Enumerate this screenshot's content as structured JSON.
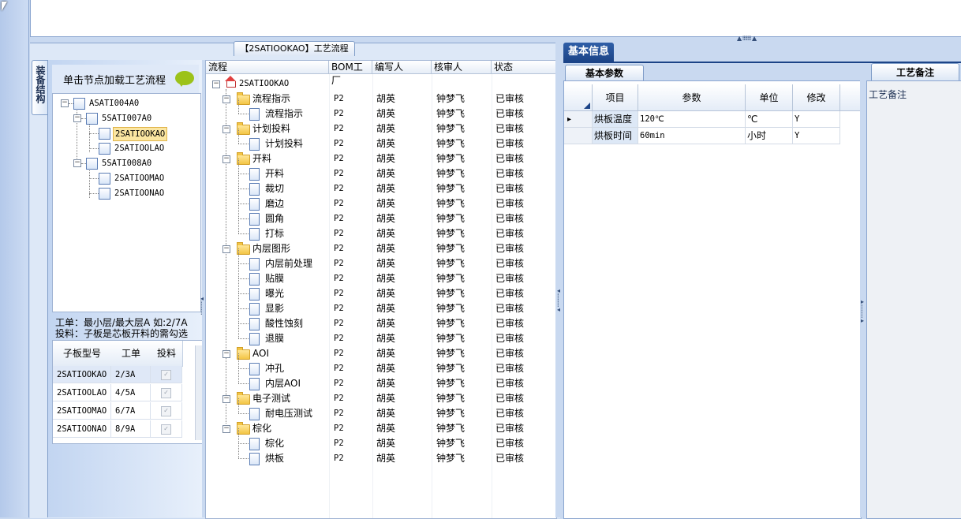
{
  "side_tab": {
    "label": "装备结构"
  },
  "tree": {
    "load_hint": "单击节点加载工艺流程",
    "nodes": [
      {
        "label": "ASATI004A0",
        "level": 0,
        "type": "group"
      },
      {
        "label": "5SATI007A0",
        "level": 1,
        "type": "group"
      },
      {
        "label": "2SATIOOKAO",
        "level": 2,
        "type": "leaf",
        "selected": true
      },
      {
        "label": "2SATIOOLAO",
        "level": 2,
        "type": "leaf"
      },
      {
        "label": "5SATI008A0",
        "level": 1,
        "type": "group"
      },
      {
        "label": "2SATIOOMAO",
        "level": 2,
        "type": "leaf"
      },
      {
        "label": "2SATIOONAO",
        "level": 2,
        "type": "leaf"
      }
    ]
  },
  "work_hint": {
    "line1": "工单：最小层/最大层A 如:2/7A",
    "line2": "投料：子板是芯板开料的需勾选"
  },
  "sub_grid": {
    "headers": [
      "子板型号",
      "工单",
      "投料"
    ],
    "rows": [
      {
        "model": "2SATIOOKAO",
        "order": "2/3A",
        "feed": true
      },
      {
        "model": "2SATIOOLAO",
        "order": "4/5A",
        "feed": true
      },
      {
        "model": "2SATIOOMAO",
        "order": "6/7A",
        "feed": true
      },
      {
        "model": "2SATIOONAO",
        "order": "8/9A",
        "feed": true
      }
    ]
  },
  "process_tab": {
    "label": "【2SATIOOKAO】工艺流程"
  },
  "process_grid": {
    "headers": [
      "流程",
      "BOM工厂",
      "编写人",
      "核审人",
      "状态"
    ],
    "root": "2SATIOOKAO",
    "rows": [
      {
        "label": "流程指示",
        "kind": "folder",
        "bom": "P2",
        "writer": "胡英",
        "reviewer": "钟梦飞",
        "status": "已审核"
      },
      {
        "label": "流程指示",
        "kind": "item",
        "bom": "P2",
        "writer": "胡英",
        "reviewer": "钟梦飞",
        "status": "已审核"
      },
      {
        "label": "计划投料",
        "kind": "folder",
        "bom": "P2",
        "writer": "胡英",
        "reviewer": "钟梦飞",
        "status": "已审核"
      },
      {
        "label": "计划投料",
        "kind": "item",
        "bom": "P2",
        "writer": "胡英",
        "reviewer": "钟梦飞",
        "status": "已审核"
      },
      {
        "label": "开料",
        "kind": "folder",
        "bom": "P2",
        "writer": "胡英",
        "reviewer": "钟梦飞",
        "status": "已审核"
      },
      {
        "label": "开料",
        "kind": "item",
        "bom": "P2",
        "writer": "胡英",
        "reviewer": "钟梦飞",
        "status": "已审核"
      },
      {
        "label": "裁切",
        "kind": "item",
        "bom": "P2",
        "writer": "胡英",
        "reviewer": "钟梦飞",
        "status": "已审核"
      },
      {
        "label": "磨边",
        "kind": "item",
        "bom": "P2",
        "writer": "胡英",
        "reviewer": "钟梦飞",
        "status": "已审核"
      },
      {
        "label": "圆角",
        "kind": "item",
        "bom": "P2",
        "writer": "胡英",
        "reviewer": "钟梦飞",
        "status": "已审核"
      },
      {
        "label": "打标",
        "kind": "item",
        "bom": "P2",
        "writer": "胡英",
        "reviewer": "钟梦飞",
        "status": "已审核"
      },
      {
        "label": "内层图形",
        "kind": "folder",
        "bom": "P2",
        "writer": "胡英",
        "reviewer": "钟梦飞",
        "status": "已审核"
      },
      {
        "label": "内层前处理",
        "kind": "item",
        "bom": "P2",
        "writer": "胡英",
        "reviewer": "钟梦飞",
        "status": "已审核"
      },
      {
        "label": "贴膜",
        "kind": "item",
        "bom": "P2",
        "writer": "胡英",
        "reviewer": "钟梦飞",
        "status": "已审核"
      },
      {
        "label": "曝光",
        "kind": "item",
        "bom": "P2",
        "writer": "胡英",
        "reviewer": "钟梦飞",
        "status": "已审核"
      },
      {
        "label": "显影",
        "kind": "item",
        "bom": "P2",
        "writer": "胡英",
        "reviewer": "钟梦飞",
        "status": "已审核"
      },
      {
        "label": "酸性蚀刻",
        "kind": "item",
        "bom": "P2",
        "writer": "胡英",
        "reviewer": "钟梦飞",
        "status": "已审核"
      },
      {
        "label": "退膜",
        "kind": "item",
        "bom": "P2",
        "writer": "胡英",
        "reviewer": "钟梦飞",
        "status": "已审核"
      },
      {
        "label": "AOI",
        "kind": "folder",
        "bom": "P2",
        "writer": "胡英",
        "reviewer": "钟梦飞",
        "status": "已审核"
      },
      {
        "label": "冲孔",
        "kind": "item",
        "bom": "P2",
        "writer": "胡英",
        "reviewer": "钟梦飞",
        "status": "已审核"
      },
      {
        "label": "内层AOI",
        "kind": "item",
        "bom": "P2",
        "writer": "胡英",
        "reviewer": "钟梦飞",
        "status": "已审核"
      },
      {
        "label": "电子测试",
        "kind": "folder",
        "bom": "P2",
        "writer": "胡英",
        "reviewer": "钟梦飞",
        "status": "已审核"
      },
      {
        "label": "耐电压测试",
        "kind": "item",
        "bom": "P2",
        "writer": "胡英",
        "reviewer": "钟梦飞",
        "status": "已审核"
      },
      {
        "label": "棕化",
        "kind": "folder",
        "bom": "P2",
        "writer": "胡英",
        "reviewer": "钟梦飞",
        "status": "已审核"
      },
      {
        "label": "棕化",
        "kind": "item",
        "bom": "P2",
        "writer": "胡英",
        "reviewer": "钟梦飞",
        "status": "已审核"
      },
      {
        "label": "烘板",
        "kind": "item",
        "bom": "P2",
        "writer": "胡英",
        "reviewer": "钟梦飞",
        "status": "已审核"
      }
    ]
  },
  "basic_info": {
    "tab_label": "基本信息",
    "param_tab_label": "基本参数",
    "headers": [
      "项目",
      "参数",
      "单位",
      "修改"
    ],
    "rows": [
      {
        "item": "烘板温度",
        "param": "120℃",
        "unit": "℃",
        "edit": "Y"
      },
      {
        "item": "烘板时间",
        "param": "60min",
        "unit": "小时",
        "edit": "Y"
      }
    ]
  },
  "notes": {
    "tab_label": "工艺备注",
    "field_label": "工艺备注"
  }
}
